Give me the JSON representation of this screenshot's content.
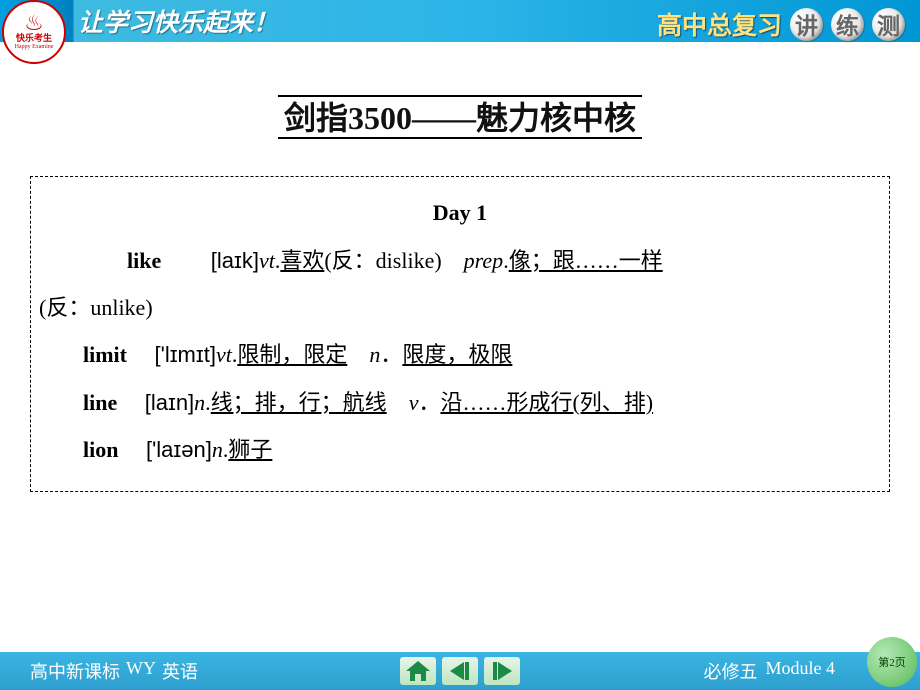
{
  "header": {
    "slogan": "让学习快乐起来！",
    "review_label": "高中总复习",
    "badges": [
      "讲",
      "练",
      "测"
    ],
    "logo_main": "快乐考生",
    "logo_sub": "Happy Examine"
  },
  "title": "剑指3500——魅力核中核",
  "day": "Day 1",
  "entries": [
    {
      "word": "like",
      "phon": "[laɪk]",
      "line_html": "<span class='pos'>vt</span>.<span class='def'>喜欢</span>(反：dislike)　<span class='pos'>prep</span>.<span class='def'>像；跟……一样</span>",
      "cont_html": "(反：unlike)"
    },
    {
      "word": "limit",
      "phon": "['lɪmɪt]",
      "line_html": "<span class='pos'>vt</span>.<span class='def'>限制，限定</span>　<span class='pos'>n</span>．<span class='def'>限度，极限</span>"
    },
    {
      "word": "line",
      "phon": "[laɪn]",
      "line_html": "<span class='pos'>n</span>.<span class='def'>线；排，行；航线</span>　<span class='pos'>v</span>．<span class='def'>沿……形成行(列、排)</span>"
    },
    {
      "word": "lion",
      "phon": "['laɪən]",
      "line_html": "<span class='pos'>n</span>.<span class='def'>狮子</span>"
    }
  ],
  "footer": {
    "left1": "高中新课标",
    "left2": "WY",
    "left3": "英语",
    "right1": "必修五",
    "right2": "Module 4",
    "page": "第2页"
  }
}
